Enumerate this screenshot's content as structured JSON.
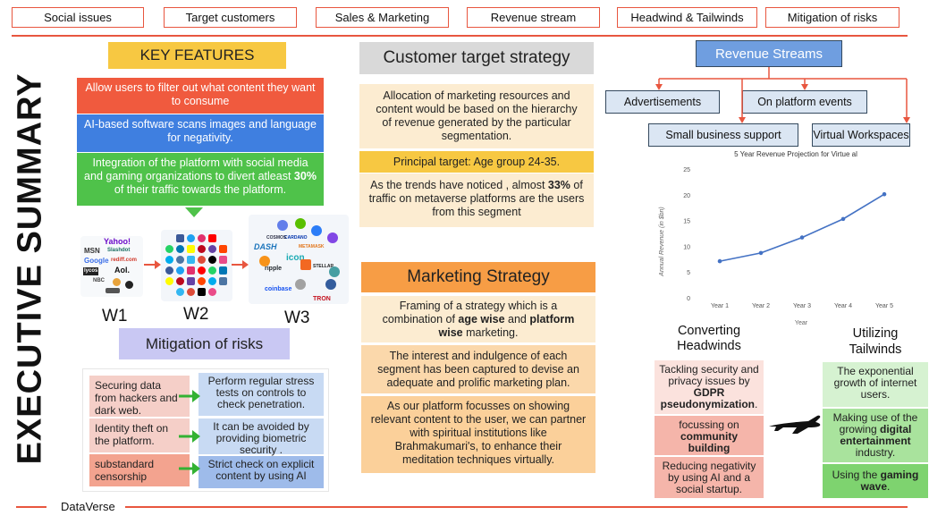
{
  "nav": [
    "Social issues",
    "Target customers",
    "Sales & Marketing",
    "Revenue stream",
    "Headwind & Tailwinds",
    "Mitigation of risks"
  ],
  "title": "EXECUTIVE SUMMARY",
  "key_features": {
    "heading": "KEY FEATURES",
    "items": [
      "Allow users to filter out what content they want to consume",
      "AI-based software scans images and language for negativity.",
      {
        "pre": "Integration of the platform with social media and gaming organizations to divert atleast ",
        "bold": "30%",
        "post": " of their traffic towards the platform."
      }
    ]
  },
  "web_stages": {
    "w1": "W1",
    "w2": "W2",
    "w3": "W3",
    "w1_logos": [
      "Yahoo!",
      "MSN",
      "Slashdot",
      "Google",
      "rediff.com",
      "lycos",
      "Aol.",
      "NBC"
    ],
    "w3_logos": [
      "DASH",
      "icon",
      "ripple",
      "coinbase",
      "TRON",
      "STELLAR",
      "METAMASK",
      "CARDANO",
      "COSMOS"
    ]
  },
  "mitigation": {
    "heading": "Mitigation of risks",
    "risks": [
      "Securing data from hackers and dark web.",
      "Identity theft on the platform.",
      "substandard censorship"
    ],
    "solutions": [
      "Perform regular stress tests on controls to check penetration.",
      "It can be avoided by providing biometric security .",
      "Strict check on explicit content by using AI"
    ]
  },
  "customer": {
    "heading": "Customer target strategy",
    "allocation": "Allocation of marketing resources and content would be based on the hierarchy of revenue generated by the particular segmentation.",
    "principal": "Principal target: Age group 24-35.",
    "trends": {
      "pre": "As the trends have noticed , almost ",
      "bold": "33%",
      "post": " of traffic on metaverse platforms are the users from this segment"
    }
  },
  "marketing": {
    "heading": "Marketing Strategy",
    "framing": {
      "pre": "Framing of a strategy which is a combination of ",
      "bold1": "age wise",
      "mid": " and ",
      "bold2": "platform wise",
      "post": " marketing."
    },
    "interest": "The interest and indulgence of each segment has been captured to devise an adequate and prolific marketing plan.",
    "platform": "As our platform focusses on showing relevant content to the user, we can partner with spiritual institutions like Brahmakumari's, to enhance their meditation techniques virtually."
  },
  "revenue": {
    "heading": "Revenue Streams",
    "streams": [
      "Advertisements",
      "On platform events",
      "Small business support",
      "Virtual Workspaces"
    ]
  },
  "chart_data": {
    "type": "line",
    "title": "5 Year Revenue Projection for Virtue al",
    "xlabel": "Year",
    "ylabel": "Annual Revenue (in $bn)",
    "categories": [
      "Year 1",
      "Year 2",
      "Year 3",
      "Year 4",
      "Year 5"
    ],
    "values": [
      7.1,
      8.7,
      11.7,
      15.3,
      20.1
    ],
    "ylim": [
      0,
      25
    ],
    "yticks": [
      0,
      5,
      10,
      15,
      20,
      25
    ],
    "grid": false,
    "color": "#4472c4"
  },
  "headwinds": {
    "heading": "Converting Headwinds",
    "items": [
      {
        "pre": "Tackling security and privacy issues by ",
        "bold": "GDPR pseudonymization",
        "post": "."
      },
      {
        "pre": "focussing on ",
        "bold": "community building",
        "post": ""
      },
      {
        "pre": "Reducing negativity by using AI and a social startup.",
        "bold": "",
        "post": ""
      }
    ]
  },
  "tailwinds": {
    "heading": "Utilizing Tailwinds",
    "items": [
      {
        "pre": "The exponential growth of internet users.",
        "bold": "",
        "post": ""
      },
      {
        "pre": "Making use of the growing ",
        "bold": "digital entertainment",
        "post": " industry."
      },
      {
        "pre": "Using the ",
        "bold": "gaming wave",
        "post": "."
      }
    ]
  },
  "footer": {
    "brand": "DataVerse"
  },
  "colors": {
    "accent": "#e8563f",
    "feature_red": "#f05a3e",
    "feature_blue": "#3f7fe0",
    "feature_green": "#4fc24a",
    "yellow": "#f7c842",
    "peach": "#fcecd1",
    "orange": "#f79d45",
    "lavender": "#c9c8f3",
    "pink": "#f5cfc8",
    "light_blue": "#c8daf3",
    "light_green": "#d6f2d1",
    "bright_green": "#7ed36f",
    "revenue_blue": "#6f9ee0"
  }
}
